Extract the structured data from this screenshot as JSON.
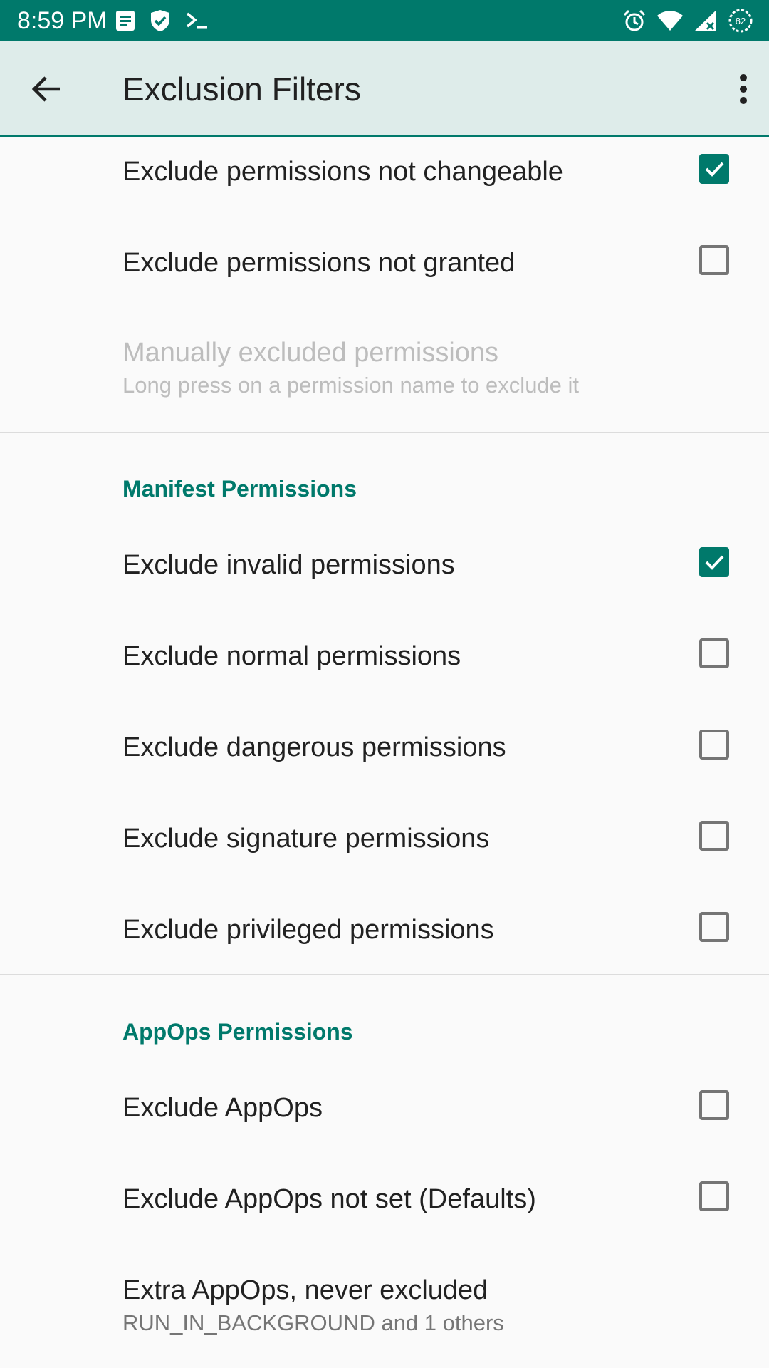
{
  "status_bar": {
    "time": "8:59 PM",
    "battery_level": "82",
    "left_icons": [
      "notes-icon",
      "shield-check-icon",
      "terminal-icon"
    ],
    "right_icons": [
      "alarm-icon",
      "wifi-icon",
      "cellular-signal-icon",
      "battery-icon"
    ]
  },
  "app_bar": {
    "title": "Exclusion Filters",
    "back_icon": "arrow-back-icon",
    "overflow_icon": "more-vert-icon"
  },
  "colors": {
    "accent": "#00796b",
    "app_bar_background": "#deecea",
    "background": "#fafafa",
    "disabled_text": "#bdbdbd"
  },
  "preferences": {
    "not_changeable": {
      "title": "Exclude permissions not changeable",
      "checked": true
    },
    "not_granted": {
      "title": "Exclude permissions not granted",
      "checked": false
    },
    "manually_excluded": {
      "title": "Manually excluded permissions",
      "summary": "Long press on a permission name to exclude it",
      "enabled": false
    }
  },
  "manifest_section": {
    "header": "Manifest Permissions",
    "items": [
      {
        "title": "Exclude invalid permissions",
        "checked": true
      },
      {
        "title": "Exclude normal permissions",
        "checked": false
      },
      {
        "title": "Exclude dangerous permissions",
        "checked": false
      },
      {
        "title": "Exclude signature permissions",
        "checked": false
      },
      {
        "title": "Exclude privileged permissions",
        "checked": false
      }
    ]
  },
  "appops_section": {
    "header": "AppOps Permissions",
    "items": [
      {
        "title": "Exclude AppOps",
        "checked": false
      },
      {
        "title": "Exclude AppOps not set (Defaults)",
        "checked": false
      }
    ],
    "extra": {
      "title": "Extra AppOps, never excluded",
      "summary": "RUN_IN_BACKGROUND and 1 others"
    }
  }
}
